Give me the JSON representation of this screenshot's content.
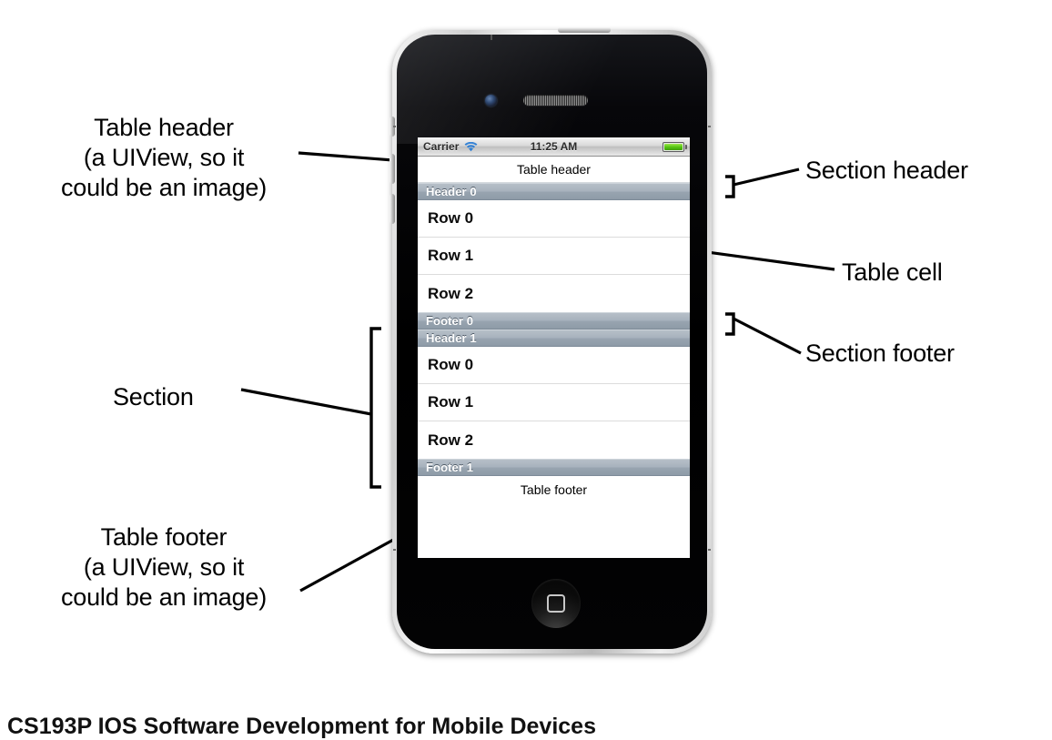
{
  "annotations": {
    "table_header": "Table header\n(a UIView, so it\ncould be an image)",
    "table_footer": "Table footer\n(a UIView, so it\ncould be an image)",
    "section": "Section",
    "section_header": "Section header",
    "section_footer": "Section footer",
    "table_cell": "Table cell"
  },
  "phone": {
    "status_bar": {
      "carrier": "Carrier",
      "time": "11:25 AM",
      "wifi_icon": "wifi-icon",
      "battery_icon": "battery-icon"
    },
    "table": {
      "header_view": "Table header",
      "footer_view": "Table footer",
      "sections": [
        {
          "header": "Header 0",
          "rows": [
            "Row 0",
            "Row 1",
            "Row 2"
          ],
          "footer": "Footer 0"
        },
        {
          "header": "Header 1",
          "rows": [
            "Row 0",
            "Row 1",
            "Row 2"
          ],
          "footer": "Footer 1"
        }
      ]
    }
  },
  "caption": "CS193P IOS Software Development for Mobile Devices",
  "colors": {
    "section_bar_top": "#b6bfc8",
    "section_bar_bottom": "#8e9ba8",
    "cell_background": "#ffffff",
    "cell_text": "#0b0b0b",
    "battery_green": "#56c513",
    "wifi_blue": "#2f7fd4"
  }
}
